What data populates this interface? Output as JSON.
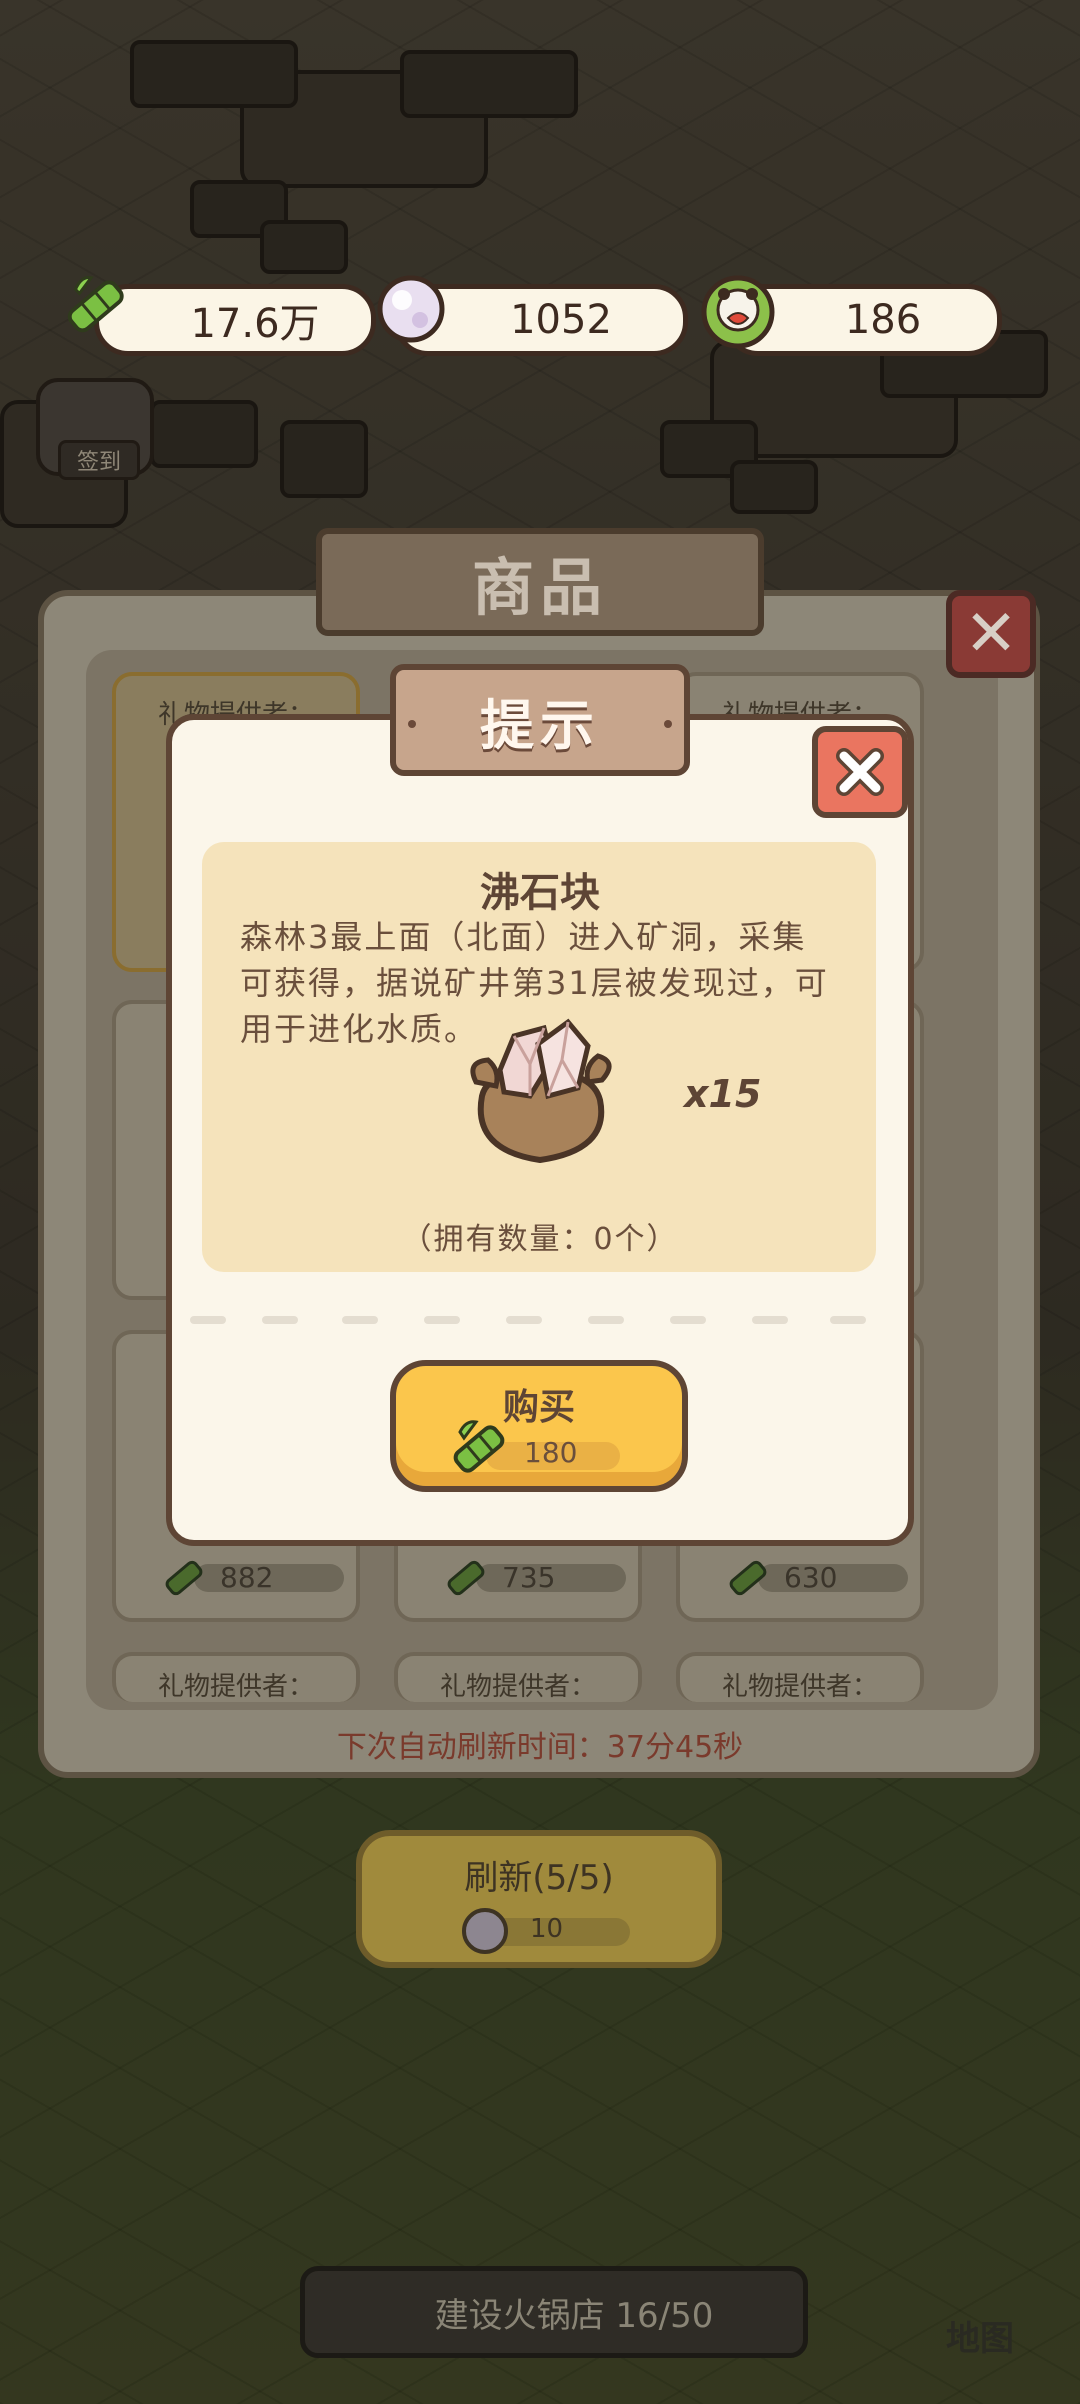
{
  "currencies": {
    "bamboo": "17.6万",
    "pearl": "1052",
    "panda_token": "186"
  },
  "widgets": {
    "sign_in": "签到",
    "map": "地图",
    "build_progress": "建设火锅店 16/50"
  },
  "shop": {
    "title": "商品",
    "gift_provider_label": "礼物提供者：",
    "prices": [
      "882",
      "735",
      "630"
    ],
    "refresh_note": "下次自动刷新时间：37分45秒",
    "refresh_button": "刷新(5/5)",
    "refresh_cost": "10"
  },
  "dialog": {
    "title": "提示",
    "item_name": "沸石块",
    "description": "森林3最上面（北面）进入矿洞，采集可获得，据说矿井第31层被发现过，可用于进化水质。",
    "quantity": "x15",
    "owned": "（拥有数量：0个）",
    "buy_label": "购买",
    "buy_cost": "180"
  },
  "colors": {
    "dialog_bg": "#fbf6ea",
    "card_bg": "#f5e3bb",
    "buy_button": "#fbc64c",
    "close_button": "#ea7560",
    "outline": "#5e4535"
  }
}
